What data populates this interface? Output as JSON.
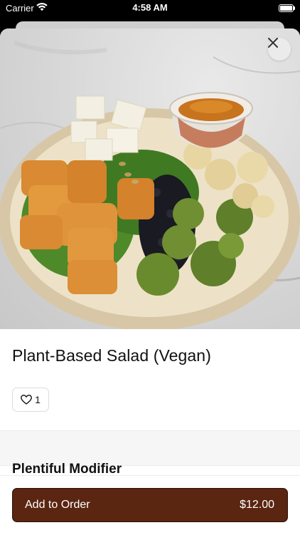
{
  "status_bar": {
    "carrier": "Carrier",
    "time": "4:58 AM",
    "wifi_icon": "wifi-icon",
    "battery_icon": "battery-icon"
  },
  "product": {
    "image_icon": "salad-photo",
    "title": "Plant-Based Salad (Vegan)",
    "favorites_count": "1",
    "favorite_icon": "heart-outline-icon"
  },
  "close_icon": "close-icon",
  "section": {
    "title": "Plentiful Modifier"
  },
  "footer": {
    "add_label": "Add to Order",
    "price": "$12.00"
  },
  "colors": {
    "accent": "#5a2511",
    "status_bar_bg": "#000000"
  }
}
